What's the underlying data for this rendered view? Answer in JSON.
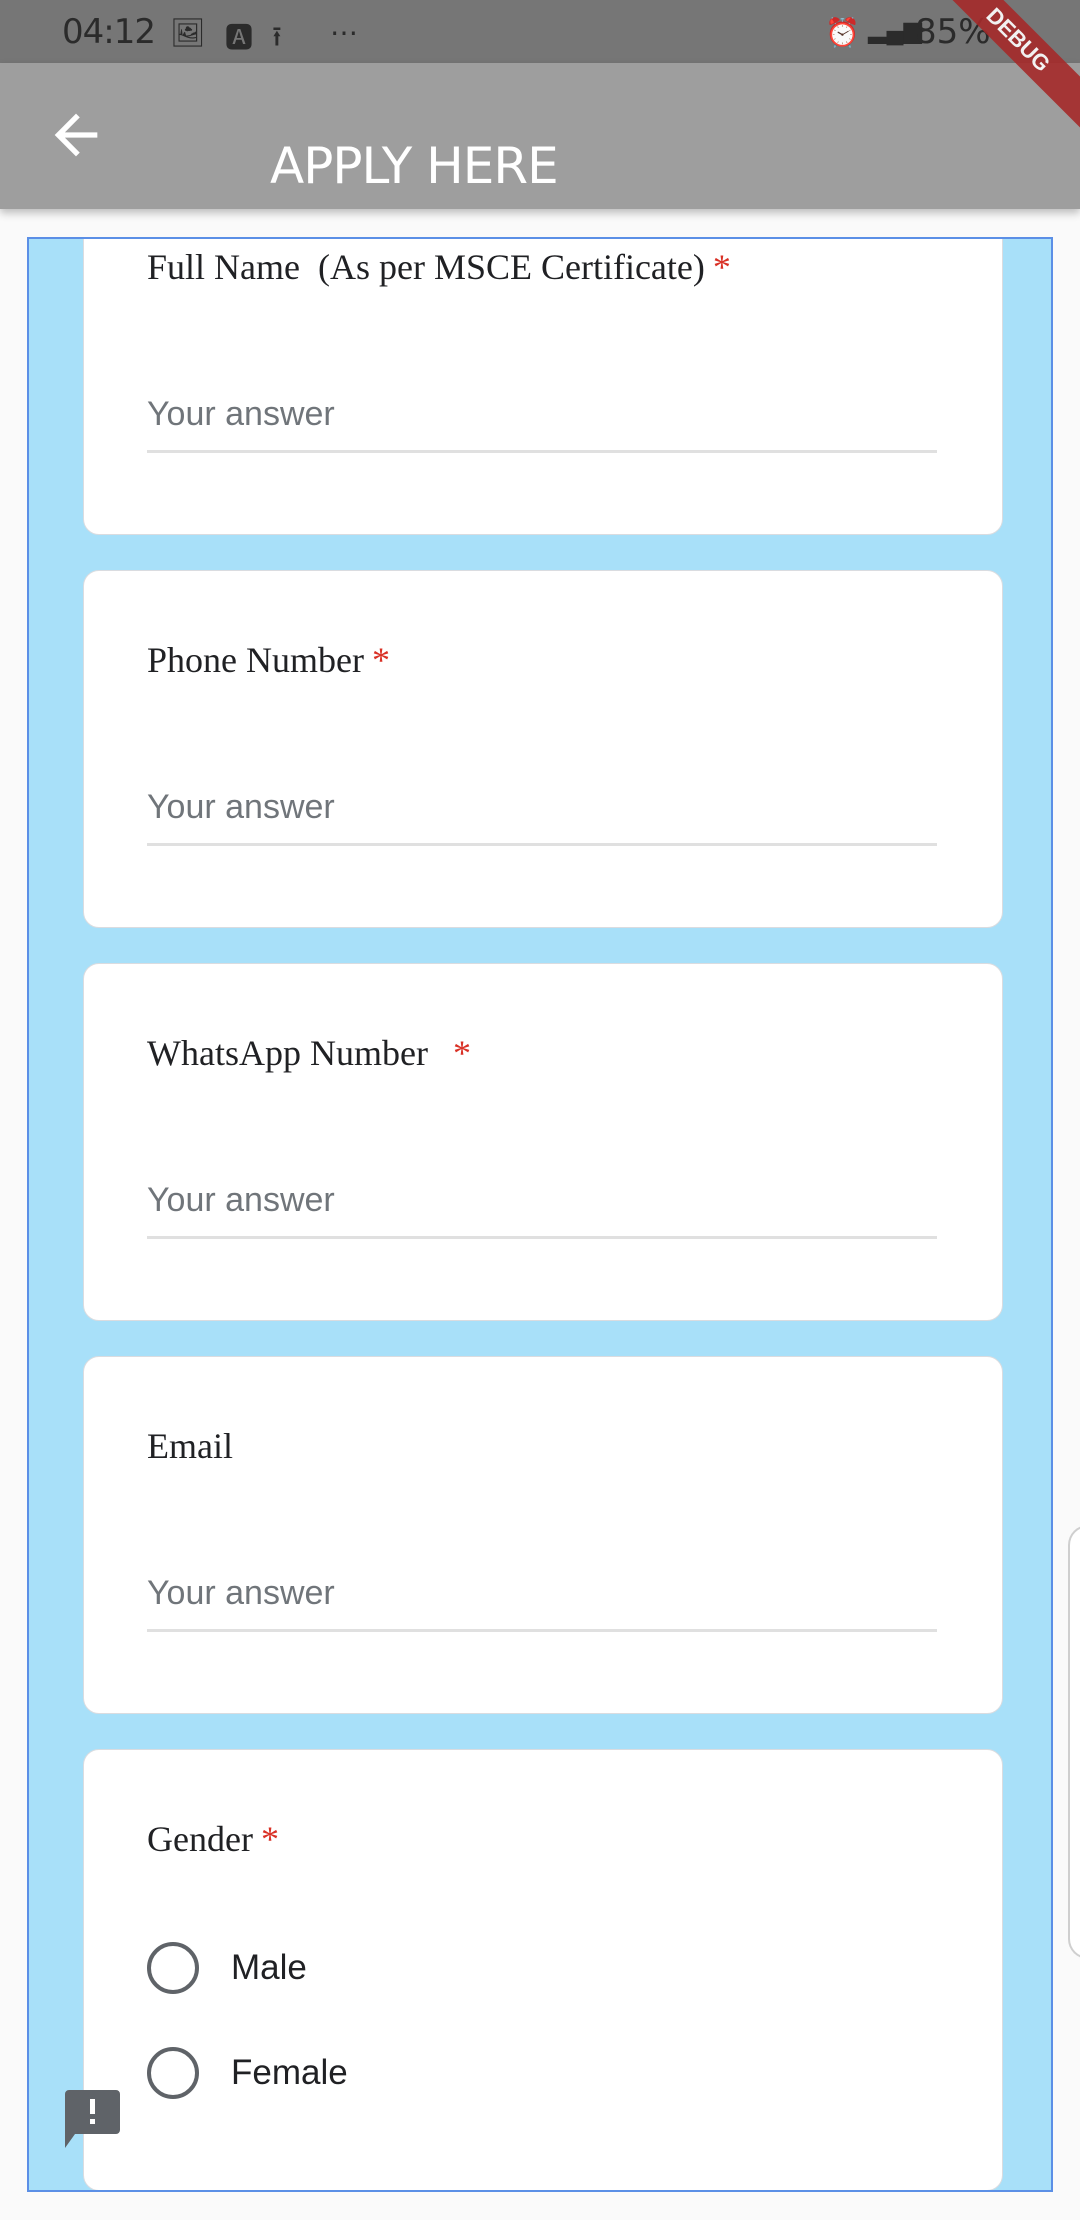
{
  "status_bar": {
    "time": "04:12",
    "battery": "85%",
    "icons": [
      "image-icon",
      "text-icon",
      "upload-icon",
      "more-icon",
      "alarm-icon",
      "lte-signal-icon",
      "battery-icon"
    ]
  },
  "app_bar": {
    "title": "APPLY HERE",
    "back_icon": "arrow-left-icon",
    "debug_banner": "DEBUG"
  },
  "colors": {
    "app_bar": "#9e9e9e",
    "container": "#a8e0f9",
    "border": "#5b8fe6",
    "required": "#d93025"
  },
  "form": {
    "fields": [
      {
        "label": "Full Name  (As per MSCE Certificate)",
        "required": "*",
        "placeholder": "Your answer",
        "value": ""
      },
      {
        "label": "Phone Number",
        "required": "*",
        "placeholder": "Your answer",
        "value": ""
      },
      {
        "label": "WhatsApp Number ",
        "required": "*",
        "placeholder": "Your answer",
        "value": ""
      },
      {
        "label": "Email",
        "required": "",
        "placeholder": "Your answer",
        "value": ""
      }
    ],
    "gender": {
      "label": "Gender",
      "required": "*",
      "options": [
        "Male",
        "Female"
      ],
      "selected": null
    }
  }
}
